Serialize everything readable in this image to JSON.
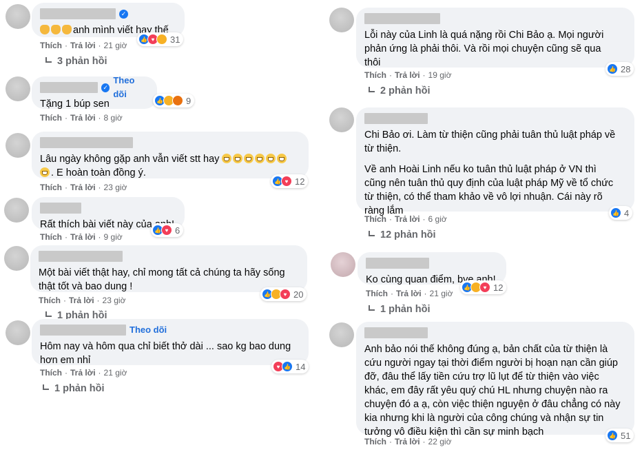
{
  "common": {
    "like": "Thích",
    "reply": "Trả lời",
    "sep": "·"
  },
  "left": [
    {
      "text": [
        "anh mình viết hay thế"
      ],
      "follow": "",
      "reacts": [
        "like",
        "love",
        "haha"
      ],
      "count": "31",
      "time": "21 giờ",
      "replies": "3 phản hồi",
      "verified": true
    },
    {
      "text": [
        "Tặng 1 búp sen"
      ],
      "follow": "Theo dõi",
      "reacts": [
        "like",
        "haha",
        "angry"
      ],
      "count": "9",
      "time": "8 giờ",
      "replies": "",
      "verified": true
    },
    {
      "text": [
        "Lâu ngày không gặp anh vẫn viết stt hay",
        ". E hoàn toàn đồng ý."
      ],
      "follow": "",
      "reacts": [
        "like",
        "love"
      ],
      "count": "12",
      "time": "23 giờ",
      "replies": "",
      "verified": false
    },
    {
      "text": [
        "Rất thích bài viết này của anh!"
      ],
      "follow": "",
      "reacts": [
        "like",
        "love"
      ],
      "count": "6",
      "time": "9 giờ",
      "replies": "",
      "verified": false
    },
    {
      "text": [
        "Một bài viết thật hay, chỉ mong tất cả chúng ta hãy sống\nthật tốt và bao dung !"
      ],
      "follow": "",
      "reacts": [
        "like",
        "care",
        "love"
      ],
      "count": "20",
      "time": "23 giờ",
      "replies": "1 phản hồi",
      "verified": false
    },
    {
      "text": [
        "Hôm nay và hôm qua chỉ biết thở dài ... sao kg bao dung\nhơn em nhỉ"
      ],
      "follow": "Theo dõi",
      "reacts": [
        "love",
        "like"
      ],
      "count": "14",
      "time": "21 giờ",
      "replies": "1 phản hồi",
      "verified": false
    }
  ],
  "right": [
    {
      "text": [
        "Lỗi này của Linh là quá nặng rồi Chi Bảo ạ. Mọi người\nphản ứng là phải thôi. Và rồi mọi chuyện cũng sẽ qua\nthôi"
      ],
      "reacts": [
        "like"
      ],
      "count": "28",
      "time": "19 giờ",
      "replies": "2 phản hồi"
    },
    {
      "text": [
        "Chi Bảo ơi. Làm từ thiện cũng phải tuân thủ luật pháp về\ntừ thiện.",
        "Về anh Hoài Linh nếu ko tuân thủ luật pháp ở VN thì\ncũng nên tuân thủ quy định của luật pháp Mỹ về tổ chức\ntừ thiện, có thể tham khảo về vô lợi nhuận. Cái này rõ\nràng lắm"
      ],
      "reacts": [
        "like"
      ],
      "count": "4",
      "time": "6 giờ",
      "replies": "12 phản hồi"
    },
    {
      "text": [
        "Ko cùng quan điểm, bye anh!"
      ],
      "reacts": [
        "like",
        "haha",
        "love"
      ],
      "count": "12",
      "time": "21 giờ",
      "replies": "1 phản hồi"
    },
    {
      "text": [
        "Anh bảo nói thế không đúng ạ, bản chất của từ thiện là\ncứu người ngay tại thời điểm người bị hoạn nạn cần giúp\nđỡ, đâu thể lấy tiền cứu trợ lũ lụt để từ thiện vào việc\nkhác, em đây rất yêu quý chú HL nhưng chuyện nào ra\nchuyện đó a ạ, còn việc thiện nguyện ở đâu chẳng có này\nkia nhưng khi là người của công chúng và nhận sự tin\ntưởng vô điều kiện thì cần sự minh bạch"
      ],
      "reacts": [
        "like"
      ],
      "count": "51",
      "time": "22 giờ",
      "replies": ""
    }
  ]
}
